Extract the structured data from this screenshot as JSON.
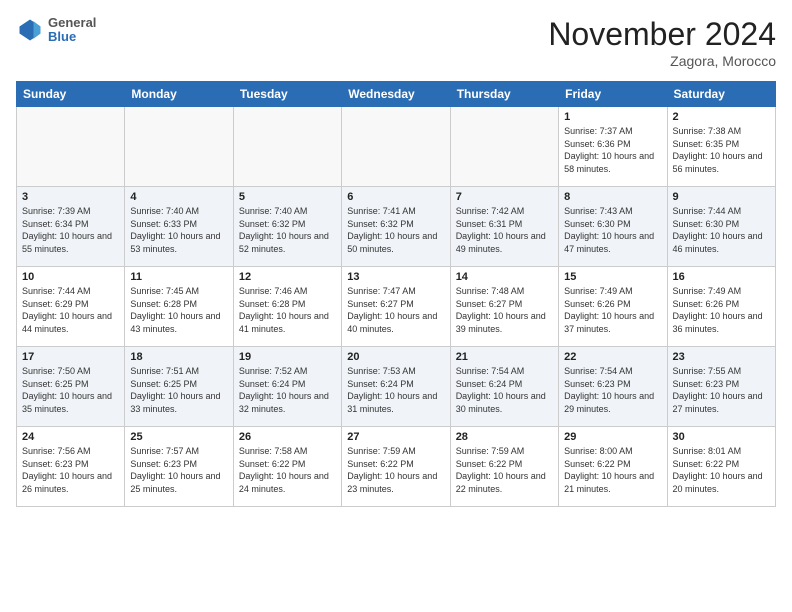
{
  "header": {
    "logo": {
      "general": "General",
      "blue": "Blue"
    },
    "title": "November 2024",
    "location": "Zagora, Morocco"
  },
  "weekdays": [
    "Sunday",
    "Monday",
    "Tuesday",
    "Wednesday",
    "Thursday",
    "Friday",
    "Saturday"
  ],
  "weeks": [
    [
      {
        "day": "",
        "sunrise": "",
        "sunset": "",
        "daylight": ""
      },
      {
        "day": "",
        "sunrise": "",
        "sunset": "",
        "daylight": ""
      },
      {
        "day": "",
        "sunrise": "",
        "sunset": "",
        "daylight": ""
      },
      {
        "day": "",
        "sunrise": "",
        "sunset": "",
        "daylight": ""
      },
      {
        "day": "",
        "sunrise": "",
        "sunset": "",
        "daylight": ""
      },
      {
        "day": "1",
        "sunrise": "Sunrise: 7:37 AM",
        "sunset": "Sunset: 6:36 PM",
        "daylight": "Daylight: 10 hours and 58 minutes."
      },
      {
        "day": "2",
        "sunrise": "Sunrise: 7:38 AM",
        "sunset": "Sunset: 6:35 PM",
        "daylight": "Daylight: 10 hours and 56 minutes."
      }
    ],
    [
      {
        "day": "3",
        "sunrise": "Sunrise: 7:39 AM",
        "sunset": "Sunset: 6:34 PM",
        "daylight": "Daylight: 10 hours and 55 minutes."
      },
      {
        "day": "4",
        "sunrise": "Sunrise: 7:40 AM",
        "sunset": "Sunset: 6:33 PM",
        "daylight": "Daylight: 10 hours and 53 minutes."
      },
      {
        "day": "5",
        "sunrise": "Sunrise: 7:40 AM",
        "sunset": "Sunset: 6:32 PM",
        "daylight": "Daylight: 10 hours and 52 minutes."
      },
      {
        "day": "6",
        "sunrise": "Sunrise: 7:41 AM",
        "sunset": "Sunset: 6:32 PM",
        "daylight": "Daylight: 10 hours and 50 minutes."
      },
      {
        "day": "7",
        "sunrise": "Sunrise: 7:42 AM",
        "sunset": "Sunset: 6:31 PM",
        "daylight": "Daylight: 10 hours and 49 minutes."
      },
      {
        "day": "8",
        "sunrise": "Sunrise: 7:43 AM",
        "sunset": "Sunset: 6:30 PM",
        "daylight": "Daylight: 10 hours and 47 minutes."
      },
      {
        "day": "9",
        "sunrise": "Sunrise: 7:44 AM",
        "sunset": "Sunset: 6:30 PM",
        "daylight": "Daylight: 10 hours and 46 minutes."
      }
    ],
    [
      {
        "day": "10",
        "sunrise": "Sunrise: 7:44 AM",
        "sunset": "Sunset: 6:29 PM",
        "daylight": "Daylight: 10 hours and 44 minutes."
      },
      {
        "day": "11",
        "sunrise": "Sunrise: 7:45 AM",
        "sunset": "Sunset: 6:28 PM",
        "daylight": "Daylight: 10 hours and 43 minutes."
      },
      {
        "day": "12",
        "sunrise": "Sunrise: 7:46 AM",
        "sunset": "Sunset: 6:28 PM",
        "daylight": "Daylight: 10 hours and 41 minutes."
      },
      {
        "day": "13",
        "sunrise": "Sunrise: 7:47 AM",
        "sunset": "Sunset: 6:27 PM",
        "daylight": "Daylight: 10 hours and 40 minutes."
      },
      {
        "day": "14",
        "sunrise": "Sunrise: 7:48 AM",
        "sunset": "Sunset: 6:27 PM",
        "daylight": "Daylight: 10 hours and 39 minutes."
      },
      {
        "day": "15",
        "sunrise": "Sunrise: 7:49 AM",
        "sunset": "Sunset: 6:26 PM",
        "daylight": "Daylight: 10 hours and 37 minutes."
      },
      {
        "day": "16",
        "sunrise": "Sunrise: 7:49 AM",
        "sunset": "Sunset: 6:26 PM",
        "daylight": "Daylight: 10 hours and 36 minutes."
      }
    ],
    [
      {
        "day": "17",
        "sunrise": "Sunrise: 7:50 AM",
        "sunset": "Sunset: 6:25 PM",
        "daylight": "Daylight: 10 hours and 35 minutes."
      },
      {
        "day": "18",
        "sunrise": "Sunrise: 7:51 AM",
        "sunset": "Sunset: 6:25 PM",
        "daylight": "Daylight: 10 hours and 33 minutes."
      },
      {
        "day": "19",
        "sunrise": "Sunrise: 7:52 AM",
        "sunset": "Sunset: 6:24 PM",
        "daylight": "Daylight: 10 hours and 32 minutes."
      },
      {
        "day": "20",
        "sunrise": "Sunrise: 7:53 AM",
        "sunset": "Sunset: 6:24 PM",
        "daylight": "Daylight: 10 hours and 31 minutes."
      },
      {
        "day": "21",
        "sunrise": "Sunrise: 7:54 AM",
        "sunset": "Sunset: 6:24 PM",
        "daylight": "Daylight: 10 hours and 30 minutes."
      },
      {
        "day": "22",
        "sunrise": "Sunrise: 7:54 AM",
        "sunset": "Sunset: 6:23 PM",
        "daylight": "Daylight: 10 hours and 29 minutes."
      },
      {
        "day": "23",
        "sunrise": "Sunrise: 7:55 AM",
        "sunset": "Sunset: 6:23 PM",
        "daylight": "Daylight: 10 hours and 27 minutes."
      }
    ],
    [
      {
        "day": "24",
        "sunrise": "Sunrise: 7:56 AM",
        "sunset": "Sunset: 6:23 PM",
        "daylight": "Daylight: 10 hours and 26 minutes."
      },
      {
        "day": "25",
        "sunrise": "Sunrise: 7:57 AM",
        "sunset": "Sunset: 6:23 PM",
        "daylight": "Daylight: 10 hours and 25 minutes."
      },
      {
        "day": "26",
        "sunrise": "Sunrise: 7:58 AM",
        "sunset": "Sunset: 6:22 PM",
        "daylight": "Daylight: 10 hours and 24 minutes."
      },
      {
        "day": "27",
        "sunrise": "Sunrise: 7:59 AM",
        "sunset": "Sunset: 6:22 PM",
        "daylight": "Daylight: 10 hours and 23 minutes."
      },
      {
        "day": "28",
        "sunrise": "Sunrise: 7:59 AM",
        "sunset": "Sunset: 6:22 PM",
        "daylight": "Daylight: 10 hours and 22 minutes."
      },
      {
        "day": "29",
        "sunrise": "Sunrise: 8:00 AM",
        "sunset": "Sunset: 6:22 PM",
        "daylight": "Daylight: 10 hours and 21 minutes."
      },
      {
        "day": "30",
        "sunrise": "Sunrise: 8:01 AM",
        "sunset": "Sunset: 6:22 PM",
        "daylight": "Daylight: 10 hours and 20 minutes."
      }
    ]
  ]
}
